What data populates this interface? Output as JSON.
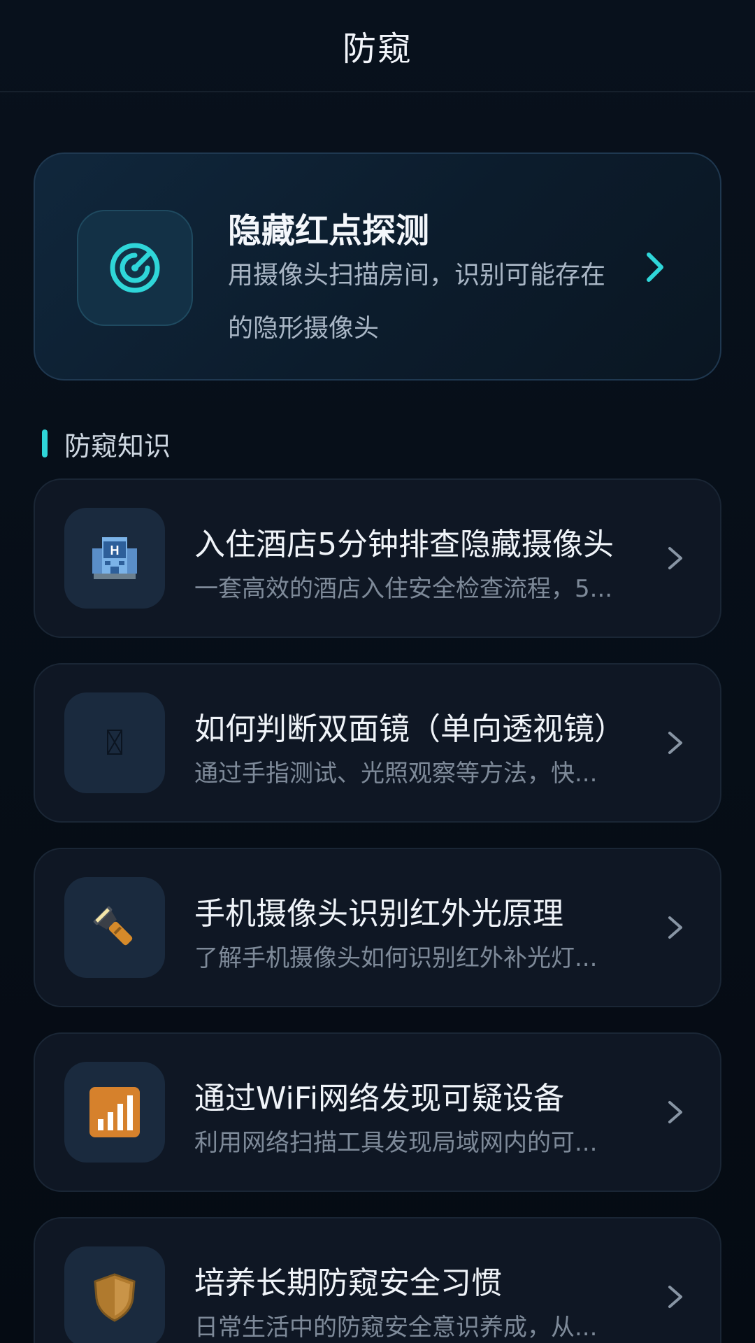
{
  "header": {
    "title": "防窥"
  },
  "hero": {
    "icon": "target-icon",
    "title": "隐藏红点探测",
    "description": "用摄像头扫描房间，识别可能存在的隐形摄像头"
  },
  "section": {
    "title": "防窥知识"
  },
  "items": [
    {
      "icon": "hotel-icon",
      "title": "入住酒店5分钟排查隐藏摄像头",
      "description": "一套高效的酒店入住安全检查流程，5..."
    },
    {
      "icon": "mirror-icon",
      "title": "如何判断双面镜（单向透视镜）",
      "description": "通过手指测试、光照观察等方法，快..."
    },
    {
      "icon": "flashlight-icon",
      "title": "手机摄像头识别红外光原理",
      "description": "了解手机摄像头如何识别红外补光灯..."
    },
    {
      "icon": "signal-bars-icon",
      "title": "通过WiFi网络发现可疑设备",
      "description": "利用网络扫描工具发现局域网内的可..."
    },
    {
      "icon": "shield-icon",
      "title": "培养长期防窥安全习惯",
      "description": "日常生活中的防窥安全意识养成，从..."
    }
  ],
  "colors": {
    "accent": "#2fd6d9",
    "background": "#060c14",
    "card": "#0f1724"
  }
}
